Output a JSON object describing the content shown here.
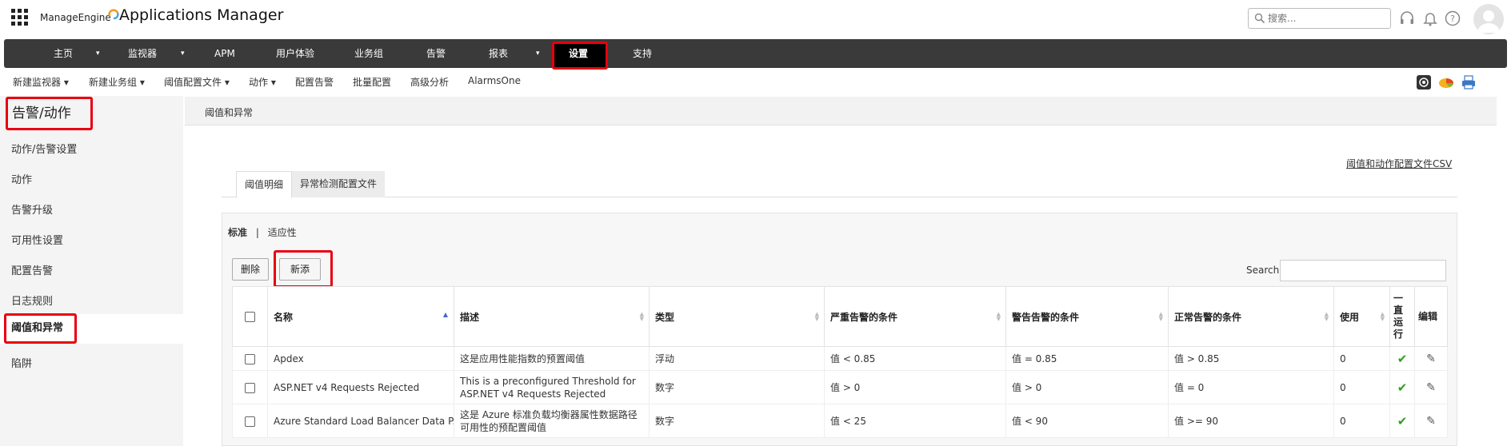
{
  "topbar": {
    "logo_small": "ManageEngine",
    "logo_big": "Applications Manager",
    "search_placeholder": "搜索..."
  },
  "nav": {
    "items": [
      {
        "label": "主页",
        "caret": true
      },
      {
        "label": "监视器",
        "caret": true
      },
      {
        "label": "APM",
        "caret": false
      },
      {
        "label": "用户体验",
        "caret": false
      },
      {
        "label": "业务组",
        "caret": false
      },
      {
        "label": "告警",
        "caret": false
      },
      {
        "label": "报表",
        "caret": true
      },
      {
        "label": "设置",
        "caret": false
      },
      {
        "label": "支持",
        "caret": false
      }
    ]
  },
  "subnav": {
    "items": [
      "新建监视器 ▾",
      "新建业务组 ▾",
      "阈值配置文件 ▾",
      "动作 ▾",
      "配置告警",
      "批量配置",
      "高级分析",
      "AlarmsOne"
    ]
  },
  "sidebar": {
    "title": "告警/动作",
    "items": [
      "动作/告警设置",
      "动作",
      "告警升级",
      "可用性设置",
      "配置告警",
      "日志规则",
      "阈值和异常",
      "陷阱"
    ]
  },
  "content": {
    "header": "阈值和异常",
    "csv_link": "阈值和动作配置文件CSV",
    "tabs": [
      "阈值明细",
      "异常检测配置文件"
    ],
    "filter_standard": "标准",
    "filter_sep": "|",
    "filter_adaptive": "适应性",
    "btn_delete": "删除",
    "btn_new": "新添",
    "search_label": "Search:"
  },
  "table": {
    "headers": [
      "名称",
      "描述",
      "类型",
      "严重告警的条件",
      "警告告警的条件",
      "正常告警的条件",
      "使用",
      "一直运行",
      "编辑"
    ],
    "rows": [
      {
        "name": "Apdex",
        "desc": "这是应用性能指数的预置阈值",
        "type": "浮动",
        "critical": "值 < 0.85",
        "warning": "值 = 0.85",
        "clear": "值 > 0.85",
        "usage": "0"
      },
      {
        "name": "ASP.NET v4 Requests Rejected",
        "desc": "This is a preconfigured Threshold for ASP.NET v4 Requests Rejected",
        "type": "数字",
        "critical": "值 > 0",
        "warning": "值 > 0",
        "clear": "值 = 0",
        "usage": "0"
      },
      {
        "name": "Azure Standard Load Balancer Data P...",
        "desc": "这是 Azure 标准负载均衡器属性数据路径可用性的预配置阈值",
        "type": "数字",
        "critical": "值 < 25",
        "warning": "值 < 90",
        "clear": "值 >= 90",
        "usage": "0"
      }
    ]
  },
  "colors": {
    "highlight": "#e8000f",
    "navbar": "#3a3a3a",
    "check": "#2f9e1d"
  }
}
